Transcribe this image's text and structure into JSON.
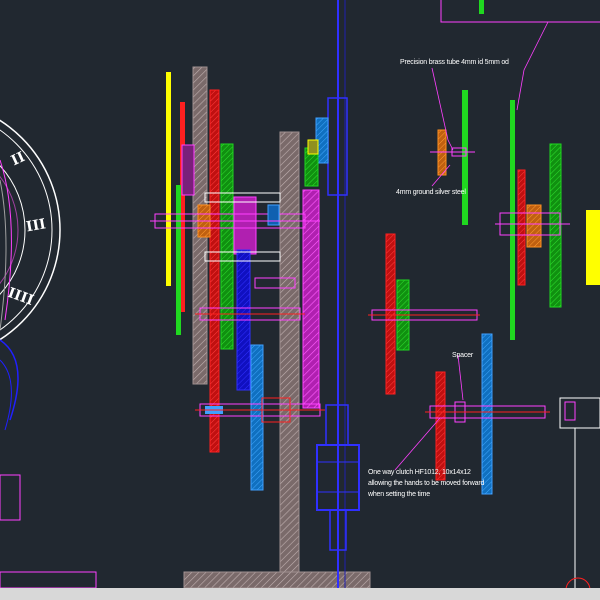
{
  "annotations": {
    "precision_tube": "Precision brass tube 4mm id 5mm od",
    "silver_steel": "4mm ground silver steel",
    "spacer": "Spacer",
    "clutch_line1": "One way clutch HF1012, 10x14x12",
    "clutch_line2": "allowing the hands to be moved forward",
    "clutch_line3": "when setting the time"
  },
  "dial_numerals": [
    "II",
    "III",
    "IIII"
  ],
  "colors": {
    "background": "#212830",
    "red": "#ff2020",
    "green": "#20d820",
    "yellow": "#ffff00",
    "magenta": "#ff40ff",
    "blue": "#2020ff",
    "cyan": "#40a0ff",
    "orange": "#ff9020",
    "white": "#ffffff"
  }
}
